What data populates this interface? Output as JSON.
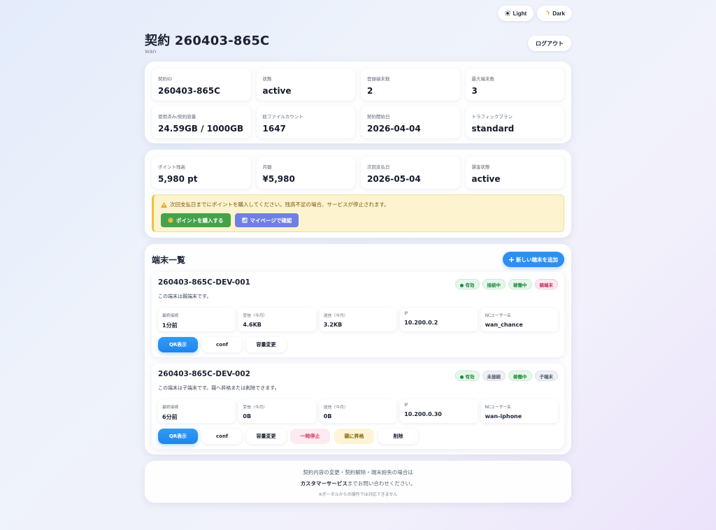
{
  "theme": {
    "light_label": "Light",
    "dark_label": "Dark"
  },
  "header": {
    "title": "契約 260403-865C",
    "user": "wan",
    "logout_label": "ログアウト"
  },
  "contract_stats": [
    {
      "label": "契約ID",
      "value": "260403-865C"
    },
    {
      "label": "状態",
      "value": "active"
    },
    {
      "label": "登録端末数",
      "value": "2"
    },
    {
      "label": "最大端末数",
      "value": "3"
    },
    {
      "label": "使用済み/契約容量",
      "value": "24.59GB / 1000GB"
    },
    {
      "label": "総ファイルカウント",
      "value": "1647"
    },
    {
      "label": "契約開始日",
      "value": "2026-04-04"
    },
    {
      "label": "トラフィックプラン",
      "value": "standard"
    }
  ],
  "billing_stats": [
    {
      "label": "ポイント残高",
      "value": "5,980 pt"
    },
    {
      "label": "月額",
      "value": "¥5,980"
    },
    {
      "label": "次回支払日",
      "value": "2026-05-04"
    },
    {
      "label": "課金状態",
      "value": "active"
    }
  ],
  "warning": {
    "text": "次回支払日までにポイントを購入してください。残高不足の場合、サービスが停止されます。",
    "buy_label": "ポイントを購入する",
    "mypage_label": "マイページで確認"
  },
  "devices_section": {
    "title": "端末一覧",
    "add_label": "新しい端末を追加"
  },
  "devices": [
    {
      "name": "260403-865C-DEV-001",
      "badges": [
        "● 有効",
        "接続中",
        "稼働中",
        "親端末"
      ],
      "description": "この端末は親端末です。",
      "stats": [
        {
          "label": "最終接続",
          "value": "1分前"
        },
        {
          "label": "受信（今月）",
          "value": "4.6KB"
        },
        {
          "label": "送信（今月）",
          "value": "3.2KB"
        },
        {
          "label": "IP",
          "value": "10.200.0.2"
        },
        {
          "label": "NCユーザー名",
          "value": "wan_chance"
        }
      ],
      "actions": {
        "qr": "QR表示",
        "conf": "conf",
        "capacity": "容量変更"
      }
    },
    {
      "name": "260403-865C-DEV-002",
      "badges": [
        "● 有効",
        "未接続",
        "稼働中",
        "子端末"
      ],
      "description": "この端末は子端末です。親へ昇格または削除できます。",
      "stats": [
        {
          "label": "最終接続",
          "value": "6分前"
        },
        {
          "label": "受信（今月）",
          "value": "0B"
        },
        {
          "label": "送信（今月）",
          "value": "0B"
        },
        {
          "label": "IP",
          "value": "10.200.0.30"
        },
        {
          "label": "NCユーザー名",
          "value": "wan-iphone"
        }
      ],
      "actions": {
        "qr": "QR表示",
        "conf": "conf",
        "capacity": "容量変更",
        "pause": "一時停止",
        "promote": "親に昇格",
        "delete": "削除"
      }
    }
  ],
  "footer": {
    "line1": "契約内容の変更・契約解除・端末紛失の場合は",
    "line2_strong": "カスタマーサービス",
    "line2_rest": "までお問い合わせください。",
    "note": "※ポータルからの操作では対応できません"
  },
  "colors": {
    "accent": "#2b90f0",
    "success": "#43a24a",
    "warning_bg": "#fdf3cf",
    "purple": "#6f7fe4"
  }
}
